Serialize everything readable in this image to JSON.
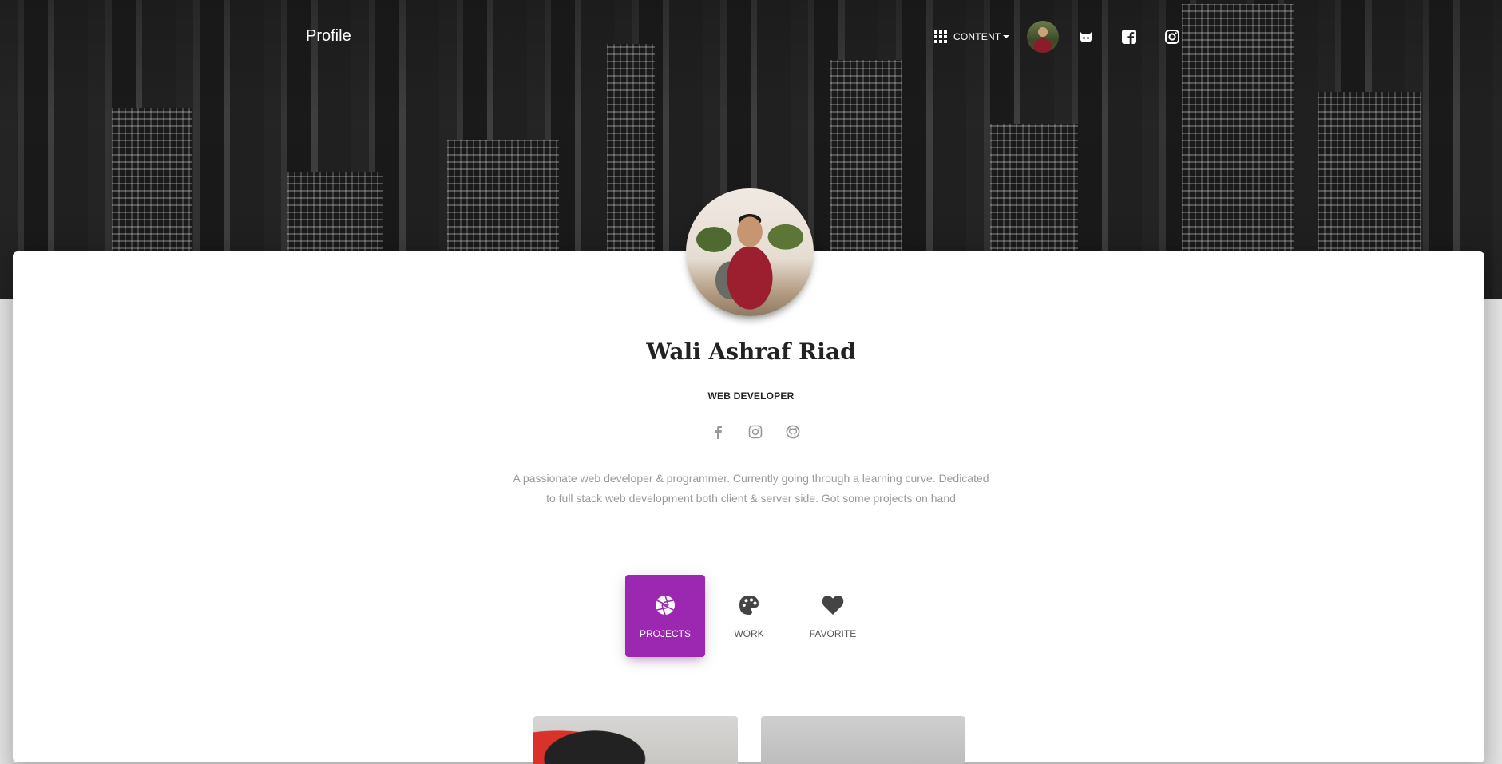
{
  "navbar": {
    "brand": "Profile",
    "content_menu_label": "CONTENT",
    "icons": [
      "apps-icon",
      "avatar",
      "github-icon",
      "facebook-icon",
      "instagram-icon"
    ]
  },
  "profile": {
    "name": "Wali Ashraf Riad",
    "title": "WEB DEVELOPER",
    "social_icons": [
      "facebook-icon",
      "instagram-icon",
      "github-icon"
    ],
    "description": "A passionate web developer & programmer. Currently going through a learning curve. Dedicated to full stack web development both client & server side. Got some projects on hand"
  },
  "tabs": [
    {
      "label": "PROJECTS",
      "icon": "camera-aperture-icon",
      "active": true
    },
    {
      "label": "WORK",
      "icon": "palette-icon",
      "active": false
    },
    {
      "label": "FAVORITE",
      "icon": "heart-icon",
      "active": false
    }
  ],
  "colors": {
    "accent": "#9c27b0",
    "text_dark": "#222222",
    "text_muted": "#999999"
  }
}
